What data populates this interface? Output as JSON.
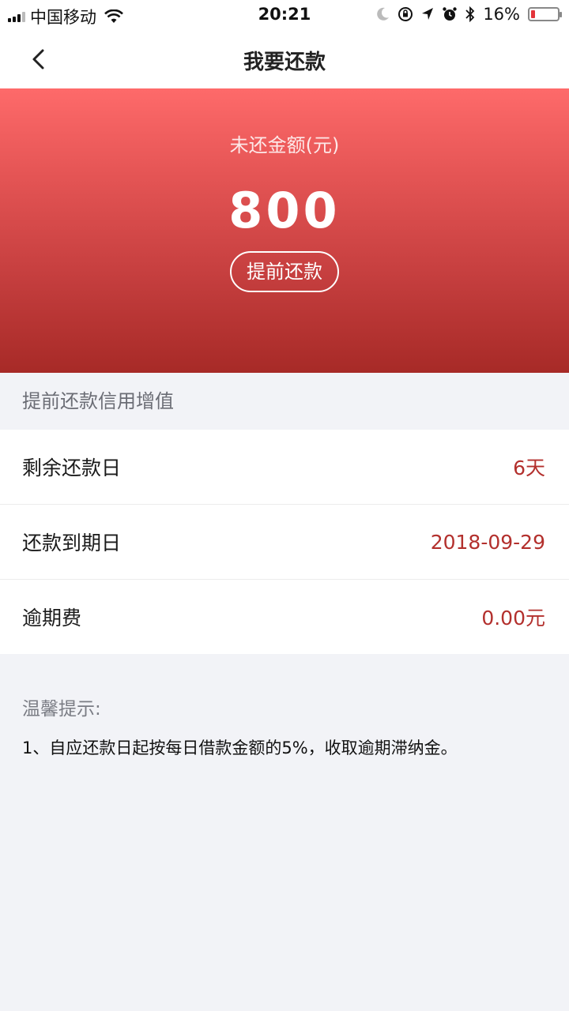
{
  "status_bar": {
    "carrier": "中国移动",
    "time": "20:21",
    "battery": "16%",
    "battery_level": 0.16,
    "icons": [
      "signal-icon",
      "wifi-icon",
      "moon-icon",
      "rotation-lock-icon",
      "location-icon",
      "alarm-icon",
      "bluetooth-icon",
      "battery-icon"
    ]
  },
  "nav": {
    "title": "我要还款",
    "back_icon": "chevron-left-icon"
  },
  "hero": {
    "label": "未还金额(元)",
    "amount": "800",
    "prepay_button": "提前还款",
    "gradient": [
      "#fe6a6a",
      "#a72a27"
    ]
  },
  "section": {
    "title": "提前还款信用增值"
  },
  "details": [
    {
      "label": "剩余还款日",
      "value": "6天"
    },
    {
      "label": "还款到期日",
      "value": "2018-09-29"
    },
    {
      "label": "逾期费",
      "value": "0.00元"
    }
  ],
  "tips": {
    "title": "温馨提示:",
    "items": [
      "1、自应还款日起按每日借款金额的5%，收取逾期滞纳金。"
    ]
  },
  "colors": {
    "accent": "#b3302d",
    "background": "#f2f3f7",
    "battery_low": "#e3343a"
  }
}
